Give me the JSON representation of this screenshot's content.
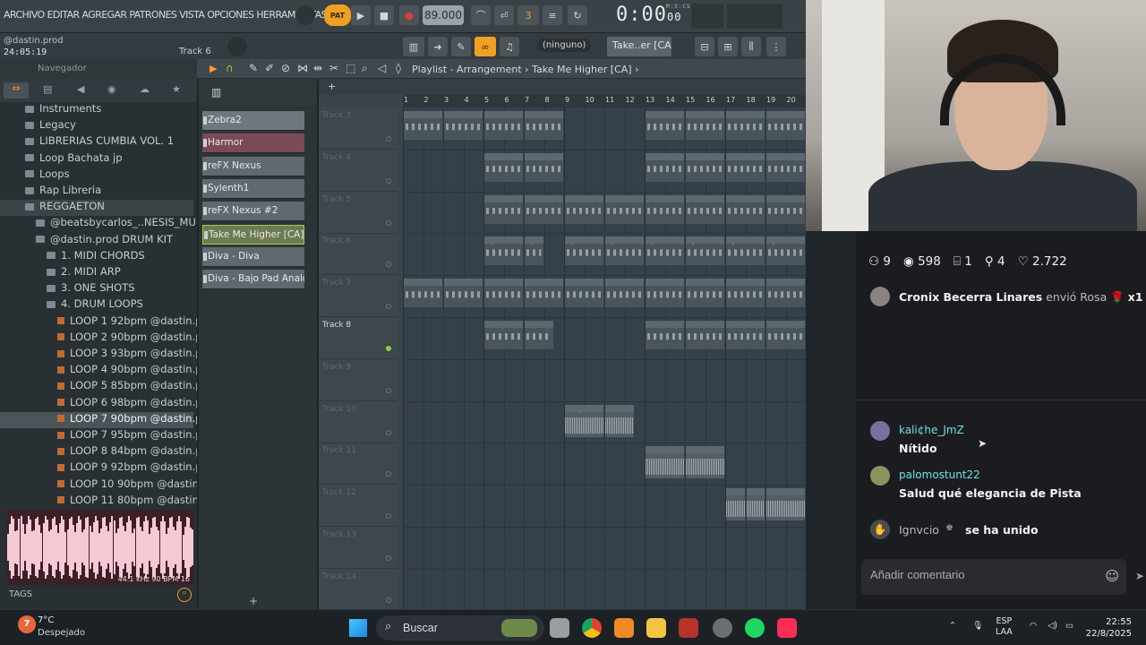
{
  "daw": {
    "menu": "ARCHIVO EDITAR AGREGAR PATRONES VISTA OPCIONES HERRAMIENTAS AYU",
    "pat_label": "PAT",
    "tempo": "89.000",
    "time": "0:00",
    "time_small": "00",
    "time_unit": "M:S:CS",
    "hint_user": "@dastin.prod",
    "clock": "24:05:19",
    "track_label": "Track 6",
    "ninguno": "(ninguno)",
    "pattern": "Take..er [CA]",
    "playlist_title": "Playlist - Arrangement",
    "playlist_pattern": "Take Me Higher [CA]"
  },
  "browser": {
    "title": "Navegador",
    "items": [
      {
        "label": "Instruments",
        "type": "folder",
        "indent": 1
      },
      {
        "label": "Legacy",
        "type": "folder",
        "indent": 1
      },
      {
        "label": "LIBRERIAS CUMBIA VOL. 1",
        "type": "folder",
        "indent": 1
      },
      {
        "label": "Loop Bachata jp",
        "type": "folder",
        "indent": 1
      },
      {
        "label": "Loops",
        "type": "folder",
        "indent": 1
      },
      {
        "label": "Rap Libreria",
        "type": "folder",
        "indent": 1
      },
      {
        "label": "REGGAETON",
        "type": "folder",
        "indent": 1,
        "state": "sel"
      },
      {
        "label": "@beatsbycarlos_..NESIS_MULTI KEY",
        "type": "folder",
        "indent": 2
      },
      {
        "label": "@dastin.prod DRUM KIT",
        "type": "folder",
        "indent": 2
      },
      {
        "label": "1. MIDI CHORDS",
        "type": "folder",
        "indent": 3
      },
      {
        "label": "2. MIDI ARP",
        "type": "folder",
        "indent": 3
      },
      {
        "label": "3. ONE SHOTS",
        "type": "folder",
        "indent": 3
      },
      {
        "label": "4. DRUM LOOPS",
        "type": "folder",
        "indent": 3
      },
      {
        "label": "LOOP 1 92bpm @dastin.prod",
        "type": "file",
        "indent": 4
      },
      {
        "label": "LOOP 2 90bpm @dastin.prod",
        "type": "file",
        "indent": 4
      },
      {
        "label": "LOOP 3 93bpm @dastin.prod",
        "type": "file",
        "indent": 4
      },
      {
        "label": "LOOP 4 90bpm @dastin.prod",
        "type": "file",
        "indent": 4
      },
      {
        "label": "LOOP 5 85bpm @dastin.prod",
        "type": "file",
        "indent": 4
      },
      {
        "label": "LOOP 6 98bpm @dastin.prod",
        "type": "file",
        "indent": 4
      },
      {
        "label": "LOOP 7 90bpm @dastin.prod",
        "type": "file",
        "indent": 4,
        "state": "active"
      },
      {
        "label": "LOOP 7 95bpm @dastin.prod",
        "type": "file",
        "indent": 4
      },
      {
        "label": "LOOP 8 84bpm @dastin.prod",
        "type": "file",
        "indent": 4
      },
      {
        "label": "LOOP 9 92bpm @dastin.prod",
        "type": "file",
        "indent": 4
      },
      {
        "label": "LOOP 10 90bpm @dastin.prod",
        "type": "file",
        "indent": 4
      },
      {
        "label": "LOOP 11 80bpm @dastin.prod",
        "type": "file",
        "indent": 4
      }
    ],
    "waveform_info": "44.1 kHz 90 BPM 16",
    "tags": "TAGS"
  },
  "channels": [
    {
      "name": "Zebra2",
      "color": "#6d777c"
    },
    {
      "name": "Harmor",
      "color": "#7a4b55"
    },
    {
      "name": "reFX Nexus",
      "color": "#5f696e"
    },
    {
      "name": "Sylenth1",
      "color": "#5f696e"
    },
    {
      "name": "reFX Nexus #2",
      "color": "#5f696e"
    },
    {
      "name": "Take Me Higher [CA]",
      "color": "#6e7a52"
    },
    {
      "name": "Diva - Diva",
      "color": "#5f696e"
    },
    {
      "name": "Diva - Bajo Pad Analogo",
      "color": "#5f696e"
    }
  ],
  "ruler": [
    "1",
    "2",
    "3",
    "4",
    "5",
    "6",
    "7",
    "8",
    "9",
    "10",
    "11",
    "12",
    "13",
    "14",
    "15",
    "16",
    "17",
    "18",
    "19",
    "20"
  ],
  "tracks": [
    "Track 3",
    "Track 4",
    "Track 5",
    "Track 6",
    "Track 7",
    "Track 8",
    "Track 9",
    "Track 10",
    "Track 11",
    "Track 12",
    "Track 13",
    "Track 14"
  ],
  "clips": [
    {
      "row": 0,
      "start": 0,
      "len": 2,
      "label": "Zebra2"
    },
    {
      "row": 0,
      "start": 2,
      "len": 2,
      "label": "Zebra2"
    },
    {
      "row": 0,
      "start": 4,
      "len": 2,
      "label": "Zebra2"
    },
    {
      "row": 0,
      "start": 6,
      "len": 2,
      "label": "Ze..2"
    },
    {
      "row": 0,
      "start": 12,
      "len": 2,
      "label": "Zebra2"
    },
    {
      "row": 0,
      "start": 14,
      "len": 2,
      "label": "Zebra2"
    },
    {
      "row": 0,
      "start": 16,
      "len": 2,
      "label": "Zebra2"
    },
    {
      "row": 0,
      "start": 18,
      "len": 2,
      "label": "Zebra2"
    },
    {
      "row": 1,
      "start": 4,
      "len": 2,
      "label": "Harmor"
    },
    {
      "row": 1,
      "start": 6,
      "len": 2,
      "label": "Ha..r"
    },
    {
      "row": 1,
      "start": 12,
      "len": 2,
      "label": "Harmor"
    },
    {
      "row": 1,
      "start": 14,
      "len": 2,
      "label": "Harmor"
    },
    {
      "row": 1,
      "start": 16,
      "len": 2,
      "label": "Harmor"
    },
    {
      "row": 1,
      "start": 18,
      "len": 2,
      "label": "Harmor"
    },
    {
      "row": 2,
      "start": 4,
      "len": 2,
      "label": "reF...xus"
    },
    {
      "row": 2,
      "start": 6,
      "len": 2,
      "label": "re..us"
    },
    {
      "row": 2,
      "start": 8,
      "len": 2,
      "label": "reF...xus"
    },
    {
      "row": 2,
      "start": 10,
      "len": 2,
      "label": "reF...xus"
    },
    {
      "row": 2,
      "start": 12,
      "len": 2,
      "label": "reF...xus"
    },
    {
      "row": 2,
      "start": 14,
      "len": 2,
      "label": "reF...xus"
    },
    {
      "row": 2,
      "start": 16,
      "len": 2,
      "label": "reF...xus"
    },
    {
      "row": 2,
      "start": 18,
      "len": 2,
      "label": "reF...xus"
    },
    {
      "row": 3,
      "start": 4,
      "len": 2,
      "label": "Sylenth1"
    },
    {
      "row": 3,
      "start": 6,
      "len": 1,
      "label": "Sy..1"
    },
    {
      "row": 3,
      "start": 8,
      "len": 2,
      "label": "Sylenth1"
    },
    {
      "row": 3,
      "start": 10,
      "len": 2,
      "label": "Sylenth1"
    },
    {
      "row": 3,
      "start": 12,
      "len": 2,
      "label": "Sylenth1"
    },
    {
      "row": 3,
      "start": 14,
      "len": 2,
      "label": "Sylenth1"
    },
    {
      "row": 3,
      "start": 16,
      "len": 2,
      "label": "Sylenth1"
    },
    {
      "row": 3,
      "start": 18,
      "len": 2,
      "label": "Sylenth1"
    },
    {
      "row": 4,
      "start": 0,
      "len": 2,
      "label": "reF...s #2"
    },
    {
      "row": 4,
      "start": 2,
      "len": 2,
      "label": "re...s #2"
    },
    {
      "row": 4,
      "start": 4,
      "len": 2,
      "label": "reF...s #2"
    },
    {
      "row": 4,
      "start": 6,
      "len": 2,
      "label": "re...s #2"
    },
    {
      "row": 4,
      "start": 8,
      "len": 2,
      "label": "reF...s #2"
    },
    {
      "row": 4,
      "start": 10,
      "len": 2,
      "label": "reF...s #2"
    },
    {
      "row": 4,
      "start": 12,
      "len": 2,
      "label": "reF...s #2"
    },
    {
      "row": 4,
      "start": 14,
      "len": 2,
      "label": "reF...s #2"
    },
    {
      "row": 4,
      "start": 16,
      "len": 2,
      "label": "reF...s #2"
    },
    {
      "row": 4,
      "start": 18,
      "len": 2,
      "label": "reF...s #2"
    },
    {
      "row": 5,
      "start": 4,
      "len": 2,
      "label": "Tak..[CA]"
    },
    {
      "row": 5,
      "start": 6,
      "len": 1.5,
      "label": "T..[CA]"
    },
    {
      "row": 5,
      "start": 12,
      "len": 2,
      "label": "Tak..[CA]"
    },
    {
      "row": 5,
      "start": 14,
      "len": 2,
      "label": "Tak..[CA]"
    },
    {
      "row": 5,
      "start": 16,
      "len": 2,
      "label": "Tak..[CA]"
    },
    {
      "row": 5,
      "start": 18,
      "len": 2,
      "label": "Tak..[CA]"
    },
    {
      "row": 7,
      "start": 8,
      "len": 2,
      "label": "LO..prod",
      "audio": true
    },
    {
      "row": 7,
      "start": 10,
      "len": 1.5,
      "label": "L..rod",
      "audio": true
    },
    {
      "row": 8,
      "start": 12,
      "len": 2,
      "label": "L..prod",
      "audio": true
    },
    {
      "row": 8,
      "start": 14,
      "len": 2,
      "label": "L..rod",
      "audio": true
    },
    {
      "row": 9,
      "start": 16,
      "len": 1,
      "label": "",
      "audio": true
    },
    {
      "row": 9,
      "start": 17,
      "len": 1,
      "label": "",
      "audio": true
    },
    {
      "row": 9,
      "start": 18,
      "len": 2,
      "label": "Loo..ster",
      "audio": true
    }
  ],
  "stream": {
    "stats": [
      {
        "icon": "people-icon",
        "value": "9"
      },
      {
        "icon": "eye-icon",
        "value": "598"
      },
      {
        "icon": "gift-icon",
        "value": "1"
      },
      {
        "icon": "user-add-icon",
        "value": "4"
      },
      {
        "icon": "heart-icon",
        "value": "2.722"
      }
    ],
    "gift": {
      "user": "Cronix Becerra Linares",
      "action": "envió Rosa",
      "count": "x1"
    },
    "comments": [
      {
        "user": "kali¢he_JmZ",
        "text": "Nítido"
      },
      {
        "user": "palomostunt22",
        "text": "Salud qué elegancia de Pista"
      }
    ],
    "join": {
      "user": "Ignvcio",
      "text": "se ha unido"
    },
    "placeholder": "Añadir comentario"
  },
  "taskbar": {
    "weather_temp": "7°C",
    "weather_desc": "Despejado",
    "weather_badge": "7",
    "search": "Buscar",
    "lang1": "ESP",
    "lang2": "LAA",
    "time": "22:55",
    "date": "22/8/2025"
  }
}
